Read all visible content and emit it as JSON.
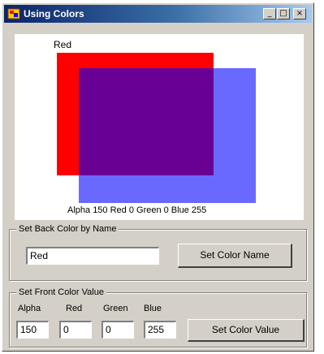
{
  "window": {
    "title": "Using Colors",
    "caption_buttons": {
      "minimize": "_",
      "maximize": "□",
      "close": "×"
    }
  },
  "canvas": {
    "top_label": "Red",
    "bottom_label": "Alpha 150 Red 0 Green 0 Blue 255",
    "red_rect_color": "#ff0000",
    "blue_rect_color": "#0000ff",
    "blue_rect_opacity_fraction": 0.59
  },
  "name_group": {
    "legend": "Set Back Color by Name",
    "name_value": "Red",
    "button_label": "Set Color Name"
  },
  "value_group": {
    "legend": "Set Front Color Value",
    "labels": {
      "alpha": "Alpha",
      "red": "Red",
      "green": "Green",
      "blue": "Blue"
    },
    "values": {
      "alpha": "150",
      "red": "0",
      "green": "0",
      "blue": "255"
    },
    "button_label": "Set Color Value"
  }
}
